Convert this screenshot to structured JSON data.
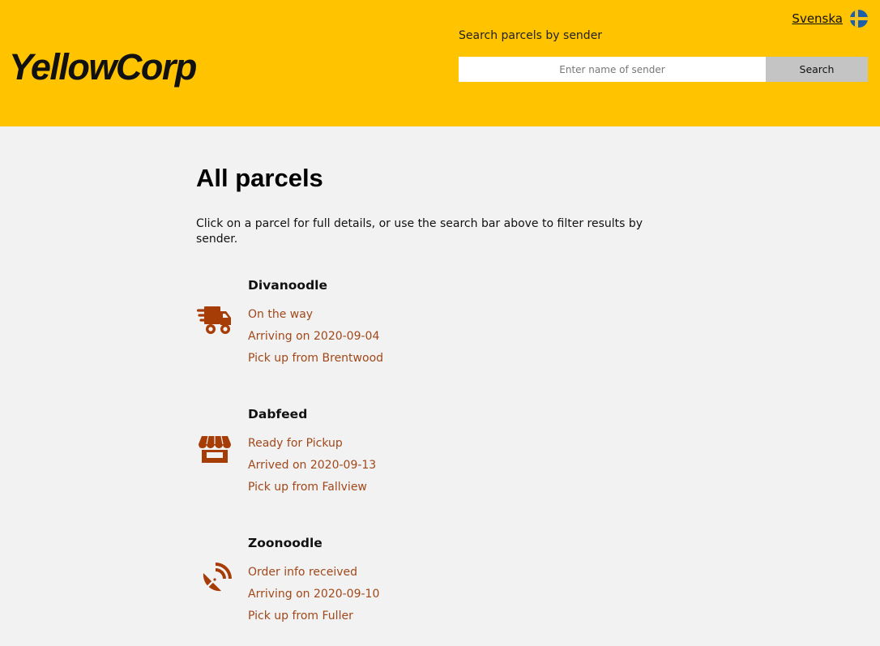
{
  "header": {
    "logo": "YellowCorp",
    "language_link": "Svenska",
    "language_flag_icon": "sweden-flag-icon",
    "search_label": "Search parcels by sender",
    "search_placeholder": "Enter name of sender",
    "search_value": "",
    "search_button": "Search"
  },
  "main": {
    "title": "All parcels",
    "intro": "Click on a parcel for full details, or use the search bar above to filter results by sender."
  },
  "parcels": [
    {
      "sender": "Divanoodle",
      "status": "On the way",
      "date": "Arriving on 2020-09-04",
      "pickup": "Pick up from Brentwood",
      "icon": "delivery-truck-icon"
    },
    {
      "sender": "Dabfeed",
      "status": "Ready for Pickup",
      "date": "Arrived on 2020-09-13",
      "pickup": "Pick up from Fallview",
      "icon": "store-icon"
    },
    {
      "sender": "Zoonoodle",
      "status": "Order info received",
      "date": "Arriving on 2020-09-10",
      "pickup": "Pick up from Fuller",
      "icon": "satellite-dish-icon"
    }
  ],
  "colors": {
    "header_background": "#ffc300",
    "page_background": "#f2f2f2",
    "accent_text": "#a0481a",
    "icon_color": "#a63c06",
    "search_button_background": "#c4c4c4"
  }
}
